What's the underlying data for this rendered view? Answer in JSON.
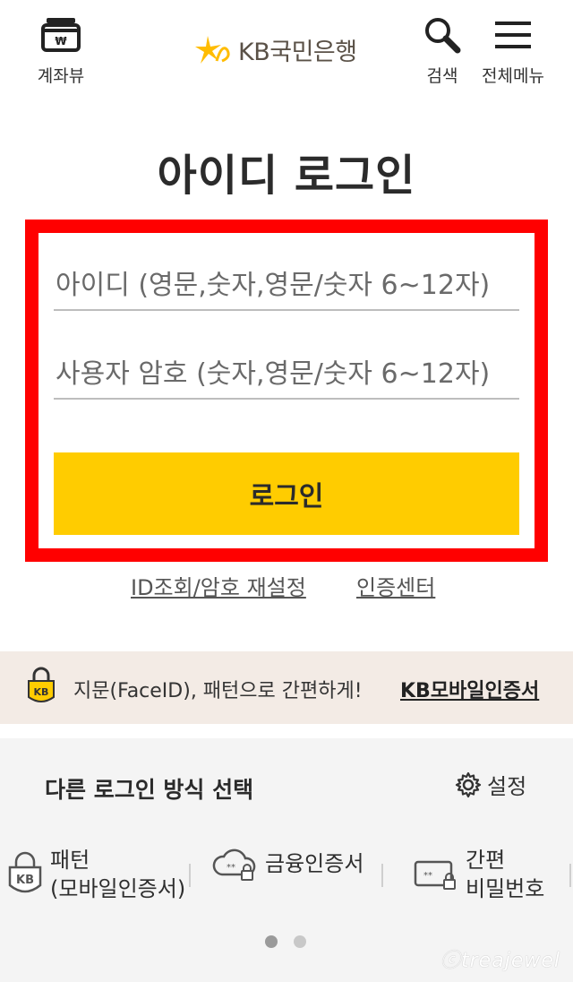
{
  "header": {
    "account_label": "계좌뷰",
    "logo_text": "KB국민은행",
    "search_label": "검색",
    "menu_label": "전체메뉴",
    "logo_color": "#ffbc00"
  },
  "title": "아이디 로그인",
  "form": {
    "id_placeholder": "아이디 (영문,숫자,영문/숫자 6~12자)",
    "pw_placeholder": "사용자 암호 (숫자,영문/숫자 6~12자)",
    "login_label": "로그인",
    "accent": "#ffcc00"
  },
  "links": {
    "find": "ID조회/암호 재설정",
    "cert": "인증센터"
  },
  "banner": {
    "text": "지문(FaceID), 패턴으로 간편하게!",
    "link": "KB모바일인증서"
  },
  "alt": {
    "title": "다른 로그인 방식 선택",
    "settings": "설정",
    "methods": [
      {
        "line1": "패턴",
        "line2": "(모바일인증서)"
      },
      {
        "line1": "금융인증서",
        "line2": ""
      },
      {
        "line1": "간편",
        "line2": "비밀번호"
      }
    ]
  },
  "watermark": "ⓒtreajewel"
}
